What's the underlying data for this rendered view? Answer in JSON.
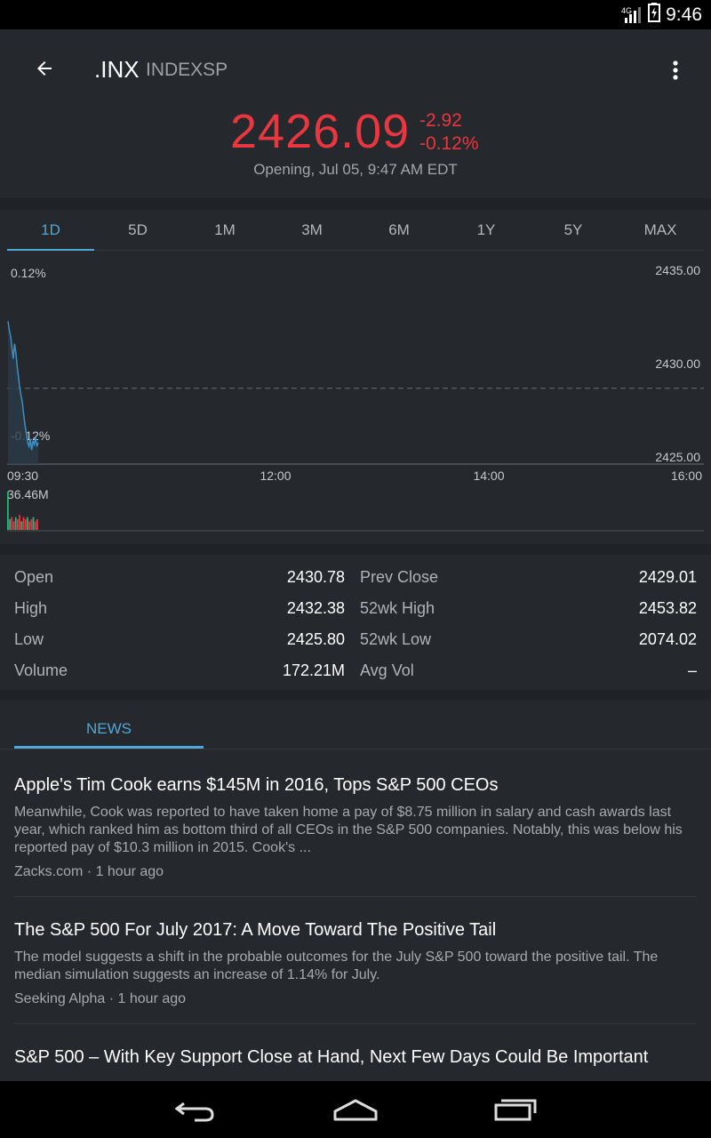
{
  "status": {
    "network": "4G",
    "time": "9:46"
  },
  "header": {
    "symbol": ".INX",
    "exchange": "INDEXSP",
    "price": "2426.09",
    "change_abs": "-2.92",
    "change_pct": "-0.12%",
    "timestamp": "Opening,  Jul 05, 9:47 AM EDT",
    "colors": {
      "negative": "#e9373f",
      "accent": "#4fa8d8"
    }
  },
  "ranges": [
    "1D",
    "5D",
    "1M",
    "3M",
    "6M",
    "1Y",
    "5Y",
    "MAX"
  ],
  "active_range": "1D",
  "chart_data": {
    "type": "line",
    "x_ticks": [
      "09:30",
      "12:00",
      "14:00",
      "16:00"
    ],
    "y_ticks_right": [
      "2435.00",
      "2430.00",
      "2425.00"
    ],
    "y_ticks_left": [
      "0.12%",
      "-0.12%"
    ],
    "ylim": [
      2425,
      2435
    ],
    "prev_close": 2429.01,
    "volume_label": "36.46M",
    "series": [
      {
        "values": [
          2432.6,
          2432.1,
          2431.8,
          2431.2,
          2430.6,
          2431.4,
          2430.9,
          2430.2,
          2429.6,
          2429.0,
          2428.6,
          2428.2,
          2427.6,
          2427.0,
          2426.6,
          2426.1,
          2425.9,
          2426.3,
          2425.7,
          2426.2,
          2426.0,
          2426.4,
          2425.9,
          2426.1
        ]
      }
    ],
    "volume_bars": [
      0.9,
      0.25,
      0.3,
      0.2,
      0.3,
      0.25,
      0.35,
      0.2,
      0.3,
      0.25,
      0.3,
      0.2,
      0.25,
      0.3,
      0.2,
      0.25
    ]
  },
  "stats": {
    "rows": [
      {
        "l1": "Open",
        "v1": "2430.78",
        "l2": "Prev Close",
        "v2": "2429.01"
      },
      {
        "l1": "High",
        "v1": "2432.38",
        "l2": "52wk High",
        "v2": "2453.82"
      },
      {
        "l1": "Low",
        "v1": "2425.80",
        "l2": "52wk Low",
        "v2": "2074.02"
      },
      {
        "l1": "Volume",
        "v1": "172.21M",
        "l2": "Avg Vol",
        "v2": "–"
      }
    ]
  },
  "news": {
    "tab_label": "NEWS",
    "items": [
      {
        "headline": "Apple's Tim Cook earns $145M in 2016, Tops S&P 500 CEOs",
        "snippet": "Meanwhile, Cook was reported to have taken home a pay of $8.75 million in salary and cash awards last year, which ranked him as bottom third of all CEOs in the S&P 500 companies. Notably, this was below his reported pay of $10.3 million in 2015. Cook's ...",
        "meta": "Zacks.com · 1 hour ago"
      },
      {
        "headline": "The S&P 500 For July 2017: A Move Toward The Positive Tail",
        "snippet": "The model suggests a shift in the probable outcomes for the July S&P 500 toward the positive tail. The median simulation suggests an increase of 1.14% for July.",
        "meta": "Seeking Alpha · 1 hour ago"
      },
      {
        "headline": "S&P 500 – With Key Support Close at Hand, Next Few Days Could Be Important",
        "snippet": "",
        "meta": ""
      }
    ]
  }
}
